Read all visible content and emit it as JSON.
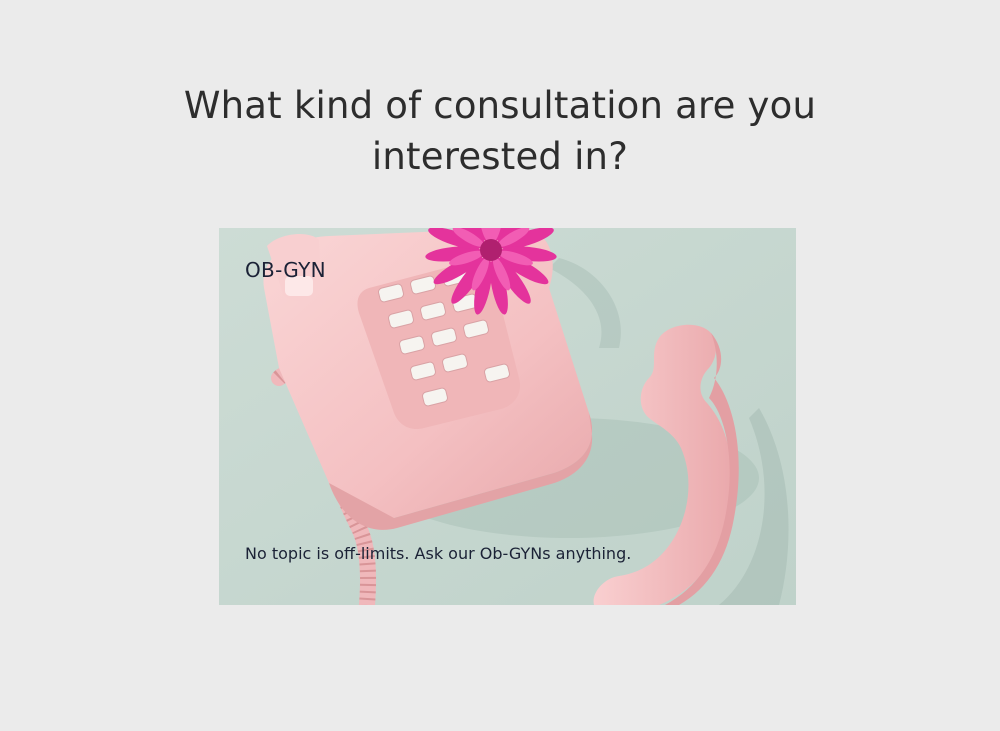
{
  "question": {
    "text": "What kind of consultation are you interested in?"
  },
  "option": {
    "title": "OB-GYN",
    "description": "No topic is off-limits. Ask our Ob-GYNs anything.",
    "image": {
      "subject": "pink rotary telephone with flower",
      "background_color": "#c6d7d0",
      "phone_color": "#f4c2c4",
      "flower_color": "#e4339c"
    }
  }
}
